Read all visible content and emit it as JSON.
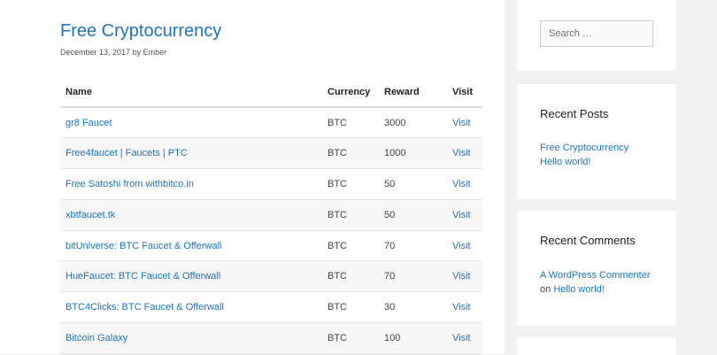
{
  "post": {
    "title": "Free Cryptocurrency",
    "date": "December 13, 2017",
    "by": "by",
    "author": "Ember"
  },
  "table": {
    "headers": {
      "name": "Name",
      "currency": "Currency",
      "reward": "Reward",
      "visit": "Visit"
    },
    "rows": [
      {
        "name": "gr8 Faucet",
        "currency": "BTC",
        "reward": "3000",
        "visit": "Visit"
      },
      {
        "name": "Free4faucet | Faucets | PTC",
        "currency": "BTC",
        "reward": "1000",
        "visit": "Visit"
      },
      {
        "name": "Free Satoshi from withbitco.in",
        "currency": "BTC",
        "reward": "50",
        "visit": "Visit"
      },
      {
        "name": "xbtfaucet.tk",
        "currency": "BTC",
        "reward": "50",
        "visit": "Visit"
      },
      {
        "name": "bitUniverse: BTC Faucet & Offerwall",
        "currency": "BTC",
        "reward": "70",
        "visit": "Visit"
      },
      {
        "name": "HueFaucet: BTC Faucet & Offerwall",
        "currency": "BTC",
        "reward": "70",
        "visit": "Visit"
      },
      {
        "name": "BTC4Clicks: BTC Faucet & Offerwall",
        "currency": "BTC",
        "reward": "30",
        "visit": "Visit"
      },
      {
        "name": "Bitcoin Galaxy",
        "currency": "BTC",
        "reward": "100",
        "visit": "Visit"
      }
    ]
  },
  "sidebar": {
    "search": {
      "placeholder": "Search …"
    },
    "recent_posts": {
      "title": "Recent Posts",
      "items": [
        "Free Cryptocurrency",
        "Hello world!"
      ]
    },
    "recent_comments": {
      "title": "Recent Comments",
      "author": "A WordPress Commenter",
      "on": "on",
      "post": "Hello world!"
    }
  },
  "colors": {
    "link": "#1e73be",
    "page_bg": "#f1f1f1",
    "panel_bg": "#ffffff"
  }
}
